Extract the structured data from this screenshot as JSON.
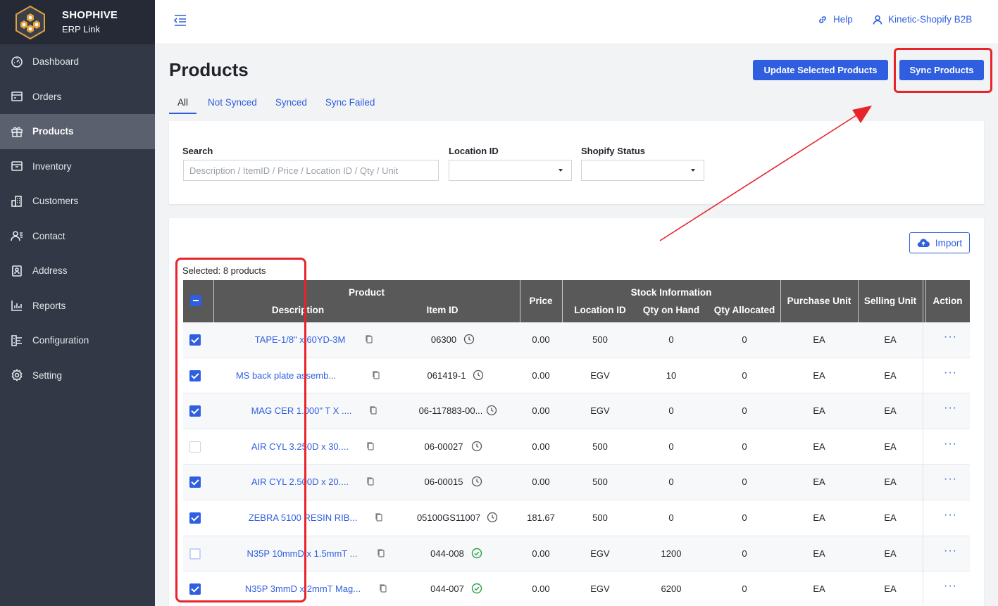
{
  "brand": {
    "name": "SHOPHIVE",
    "sub": "ERP Link"
  },
  "sidebar": {
    "items": [
      {
        "label": "Dashboard",
        "icon": "dashboard-icon"
      },
      {
        "label": "Orders",
        "icon": "orders-icon"
      },
      {
        "label": "Products",
        "icon": "gift-icon",
        "active": true
      },
      {
        "label": "Inventory",
        "icon": "inventory-icon"
      },
      {
        "label": "Customers",
        "icon": "building-icon"
      },
      {
        "label": "Contact",
        "icon": "contact-icon"
      },
      {
        "label": "Address",
        "icon": "address-book-icon"
      },
      {
        "label": "Reports",
        "icon": "bar-chart-icon"
      },
      {
        "label": "Configuration",
        "icon": "configuration-icon"
      },
      {
        "label": "Setting",
        "icon": "gear-icon"
      }
    ]
  },
  "topbar": {
    "help": "Help",
    "account": "Kinetic-Shopify B2B"
  },
  "page": {
    "title": "Products",
    "update_button": "Update Selected Products",
    "sync_button": "Sync Products"
  },
  "tabs": [
    {
      "label": "All",
      "active": true
    },
    {
      "label": "Not Synced"
    },
    {
      "label": "Synced"
    },
    {
      "label": "Sync Failed"
    }
  ],
  "filters": {
    "search_label": "Search",
    "search_placeholder": "Description / ItemID / Price / Location ID / Qty / Unit",
    "location_label": "Location ID",
    "status_label": "Shopify Status"
  },
  "table": {
    "import_button": "Import",
    "selected_text": "Selected: 8 products",
    "headers": {
      "product": "Product",
      "description": "Description",
      "item_id": "Item ID",
      "price": "Price",
      "stock": "Stock Information",
      "location": "Location ID",
      "qty_on_hand": "Qty on Hand",
      "qty_allocated": "Qty Allocated",
      "purchase_unit": "Purchase Unit",
      "selling_unit": "Selling Unit",
      "action": "Action"
    },
    "rows": [
      {
        "checked": true,
        "description": "TAPE-1/8\" x 60YD-3M",
        "item_id": "06300",
        "status": "pending",
        "price": "0.00",
        "location": "500",
        "qty_on_hand": "0",
        "qty_allocated": "0",
        "purchase_unit": "EA",
        "selling_unit": "EA"
      },
      {
        "checked": true,
        "description": "MS back plate assemb...",
        "item_id": "061419-1",
        "status": "pending",
        "price": "0.00",
        "location": "EGV",
        "qty_on_hand": "10",
        "qty_allocated": "0",
        "purchase_unit": "EA",
        "selling_unit": "EA"
      },
      {
        "checked": true,
        "description": "MAG CER 1.000\" T X ....",
        "item_id": "06-117883-00...",
        "status": "pending",
        "price": "0.00",
        "location": "EGV",
        "qty_on_hand": "0",
        "qty_allocated": "0",
        "purchase_unit": "EA",
        "selling_unit": "EA"
      },
      {
        "checked": false,
        "description": "AIR CYL 3.250D x 30....",
        "item_id": "06-00027",
        "status": "pending",
        "price": "0.00",
        "location": "500",
        "qty_on_hand": "0",
        "qty_allocated": "0",
        "purchase_unit": "EA",
        "selling_unit": "EA"
      },
      {
        "checked": true,
        "description": "AIR CYL 2.500D x 20....",
        "item_id": "06-00015",
        "status": "pending",
        "price": "0.00",
        "location": "500",
        "qty_on_hand": "0",
        "qty_allocated": "0",
        "purchase_unit": "EA",
        "selling_unit": "EA"
      },
      {
        "checked": true,
        "description": "ZEBRA 5100 RESIN RIB...",
        "item_id": "05100GS11007",
        "status": "pending",
        "price": "181.67",
        "location": "500",
        "qty_on_hand": "0",
        "qty_allocated": "0",
        "purchase_unit": "EA",
        "selling_unit": "EA"
      },
      {
        "checked": false,
        "focus": true,
        "description": "N35P 10mmD x 1.5mmT ...",
        "item_id": "044-008",
        "status": "synced",
        "price": "0.00",
        "location": "EGV",
        "qty_on_hand": "1200",
        "qty_allocated": "0",
        "purchase_unit": "EA",
        "selling_unit": "EA"
      },
      {
        "checked": true,
        "description": "N35P 3mmD x 2mmT Mag...",
        "item_id": "044-007",
        "status": "synced",
        "price": "0.00",
        "location": "EGV",
        "qty_on_hand": "6200",
        "qty_allocated": "0",
        "purchase_unit": "EA",
        "selling_unit": "EA"
      }
    ],
    "action_glyph": "···"
  },
  "colors": {
    "sidebar": "#333846",
    "brand_bar": "#252a36",
    "accent": "#2f5fe0",
    "highlight": "#e8232a",
    "header": "#595959",
    "synced": "#2aa14a"
  }
}
